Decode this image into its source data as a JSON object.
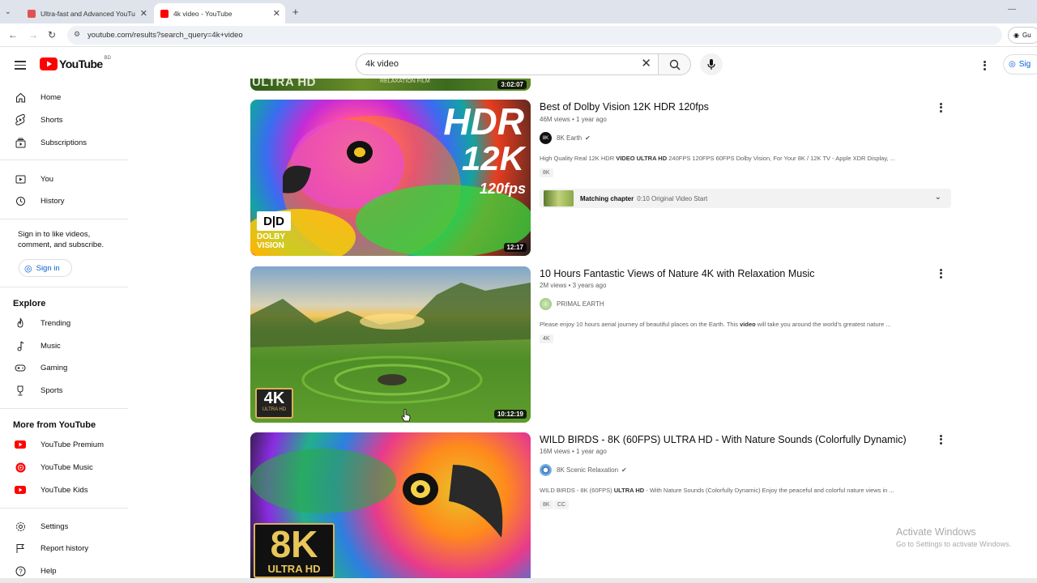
{
  "browser": {
    "tabs": [
      {
        "title": "Ultra-fast and Advanced YouTu",
        "active": false
      },
      {
        "title": "4k video - YouTube",
        "active": true
      }
    ],
    "new_tab_label": "+",
    "url": "youtube.com/results?search_query=4k+video",
    "profile_label": "Gu"
  },
  "header": {
    "logo_text": "YouTube",
    "logo_country": "BD",
    "search_value": "4k video",
    "signin_label": "Sig"
  },
  "sidebar": {
    "main": [
      {
        "label": "Home",
        "icon": "home-icon"
      },
      {
        "label": "Shorts",
        "icon": "shorts-icon"
      },
      {
        "label": "Subscriptions",
        "icon": "subscriptions-icon"
      }
    ],
    "you": [
      {
        "label": "You",
        "icon": "you-icon"
      },
      {
        "label": "History",
        "icon": "history-icon"
      }
    ],
    "signin_prompt": "Sign in to like videos, comment, and subscribe.",
    "signin_button": "Sign in",
    "explore_title": "Explore",
    "explore": [
      {
        "label": "Trending",
        "icon": "trending-icon"
      },
      {
        "label": "Music",
        "icon": "music-icon"
      },
      {
        "label": "Gaming",
        "icon": "gaming-icon"
      },
      {
        "label": "Sports",
        "icon": "sports-icon"
      }
    ],
    "more_title": "More from YouTube",
    "more": [
      {
        "label": "YouTube Premium",
        "icon": "youtube-premium-icon"
      },
      {
        "label": "YouTube Music",
        "icon": "youtube-music-icon"
      },
      {
        "label": "YouTube Kids",
        "icon": "youtube-kids-icon"
      }
    ],
    "bottom": [
      {
        "label": "Settings",
        "icon": "settings-icon"
      },
      {
        "label": "Report history",
        "icon": "flag-icon"
      },
      {
        "label": "Help",
        "icon": "help-icon"
      }
    ]
  },
  "results": [
    {
      "title": "Best of Dolby Vision 12K HDR 120fps",
      "meta": "46M views • 1 year ago",
      "channel": "8K Earth",
      "verified": true,
      "desc_pre": "High Quality Real 12K HDR ",
      "desc_bold": "VIDEO ULTRA HD",
      "desc_post": " 240FPS 120FPS 60FPS Dolby Vision, For Your 8K / 12K TV - Apple XDR Display, ...",
      "badges": [
        "8K"
      ],
      "duration": "12:17",
      "thumb_text_big": "HDR",
      "thumb_text_2": "12K",
      "thumb_text_3": "120fps",
      "thumb_logo_1": "DOLBY",
      "thumb_logo_2": "VISION",
      "chapter_label": "Matching chapter",
      "chapter_value": "0:10 Original Video Start"
    },
    {
      "title": "10 Hours Fantastic Views of Nature 4K with Relaxation Music",
      "meta": "2M views • 3 years ago",
      "channel": "PRIMAL EARTH",
      "verified": false,
      "desc_pre": "Please enjoy 10 hours aerial journey of beautiful places on the Earth. This ",
      "desc_bold": "video",
      "desc_post": " will take you around the world's greatest nature ...",
      "badges": [
        "4K"
      ],
      "duration": "10:12:19",
      "thumb_text_big": "4K",
      "thumb_text_2": "ULTRA HD"
    },
    {
      "title": "WILD BIRDS - 8K (60FPS) ULTRA HD - With Nature Sounds (Colorfully Dynamic)",
      "meta": "16M views • 1 year ago",
      "channel": "8K Scenic Relaxation",
      "verified": true,
      "desc_pre": "WILD BIRDS - 8K (60FPS) ",
      "desc_bold": "ULTRA HD",
      "desc_post": " - With Nature Sounds (Colorfully Dynamic) Enjoy the peaceful and colorful nature views in ...",
      "badges": [
        "8K",
        "CC"
      ],
      "thumb_text_big": "8K",
      "thumb_text_2": "ULTRA HD"
    }
  ],
  "top_partial": {
    "thumb_text": "ULTRA HD",
    "thumb_text_2": "RELAXATION FILM",
    "duration": "3:02:07"
  },
  "watermark": {
    "line1": "Activate Windows",
    "line2": "Go to Settings to activate Windows."
  },
  "colors": {
    "brand_red": "#ff0000",
    "link_blue": "#065fd4"
  }
}
